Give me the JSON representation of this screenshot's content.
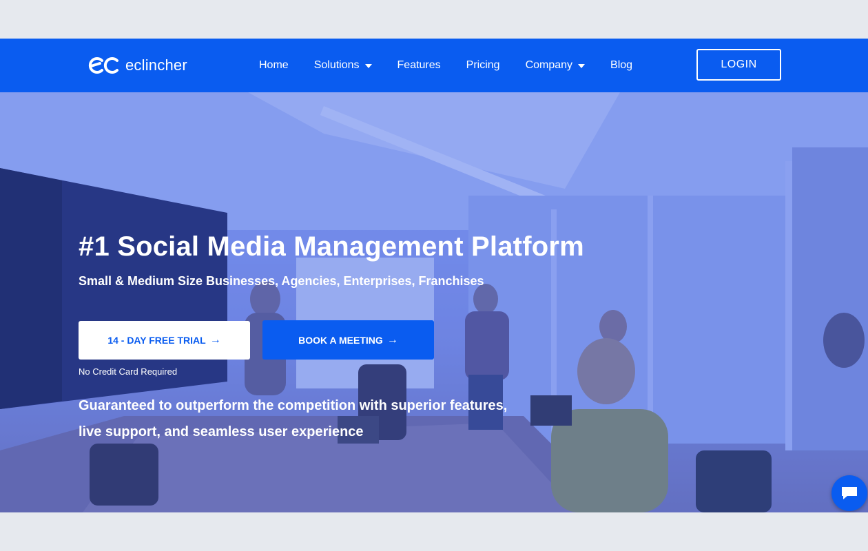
{
  "brand": {
    "name": "eclincher",
    "accent": "#0a5cf0"
  },
  "nav": {
    "items": [
      {
        "label": "Home",
        "dropdown": false
      },
      {
        "label": "Solutions",
        "dropdown": true
      },
      {
        "label": "Features",
        "dropdown": false
      },
      {
        "label": "Pricing",
        "dropdown": false
      },
      {
        "label": "Company",
        "dropdown": true
      },
      {
        "label": "Blog",
        "dropdown": false
      }
    ],
    "login_label": "LOGIN"
  },
  "hero": {
    "title": "#1 Social Media Management Platform",
    "subtitle": "Small & Medium Size Businesses, Agencies, Enterprises, Franchises",
    "trial_button": "14 - DAY FREE TRIAL",
    "meeting_button": "BOOK A MEETING",
    "no_credit_card": "No Credit Card Required",
    "tagline_line1": "Guaranteed to outperform the competition with superior features,",
    "tagline_line2": "live support, and seamless user experience"
  },
  "chat": {
    "icon": "chat-bubble-icon"
  }
}
